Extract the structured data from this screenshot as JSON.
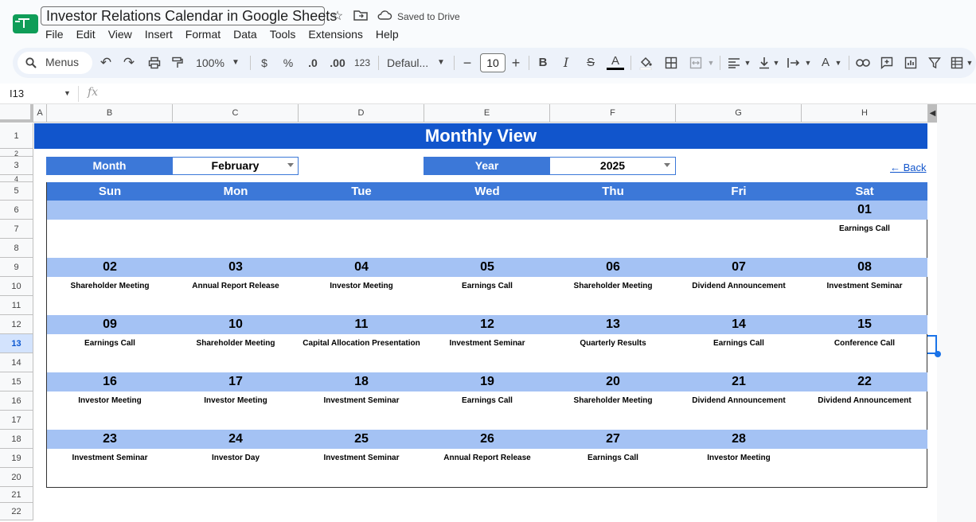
{
  "app": {
    "doc_title": "Investor Relations Calendar in Google Sheets",
    "saved_status": "Saved to Drive",
    "menu": [
      "File",
      "Edit",
      "View",
      "Insert",
      "Format",
      "Data",
      "Tools",
      "Extensions",
      "Help"
    ]
  },
  "toolbar": {
    "search_label": "Menus",
    "zoom": "100%",
    "currency": "$",
    "percent": "%",
    "dec_decrease": ".0",
    "dec_increase": ".00",
    "number_format": "123",
    "font": "Defaul...",
    "font_size": "10",
    "minus": "−",
    "plus": "+"
  },
  "formula_bar": {
    "name_box": "I13",
    "fx": "fx"
  },
  "columns": [
    "A",
    "B",
    "C",
    "D",
    "E",
    "F",
    "G",
    "H"
  ],
  "rows": [
    "1",
    "2",
    "3",
    "4",
    "5",
    "6",
    "7",
    "8",
    "9",
    "10",
    "11",
    "12",
    "13",
    "14",
    "15",
    "16",
    "17",
    "18",
    "19",
    "20",
    "21",
    "22"
  ],
  "selected_row": "13",
  "sheet": {
    "banner": "Monthly View",
    "month_label": "Month",
    "month_value": "February",
    "year_label": "Year",
    "year_value": "2025",
    "back_link": "← Back",
    "day_headers": [
      "Sun",
      "Mon",
      "Tue",
      "Wed",
      "Thu",
      "Fri",
      "Sat"
    ],
    "weeks": [
      {
        "dates": [
          "",
          "",
          "",
          "",
          "",
          "",
          "01"
        ],
        "events": [
          "",
          "",
          "",
          "",
          "",
          "",
          "Earnings Call"
        ]
      },
      {
        "dates": [
          "02",
          "03",
          "04",
          "05",
          "06",
          "07",
          "08"
        ],
        "events": [
          "Shareholder Meeting",
          "Annual Report Release",
          "Investor Meeting",
          "Earnings Call",
          "Shareholder Meeting",
          "Dividend Announcement",
          "Investment Seminar"
        ]
      },
      {
        "dates": [
          "09",
          "10",
          "11",
          "12",
          "13",
          "14",
          "15"
        ],
        "events": [
          "Earnings Call",
          "Shareholder Meeting",
          "Capital Allocation Presentation",
          "Investment Seminar",
          "Quarterly Results",
          "Earnings Call",
          "Conference Call"
        ]
      },
      {
        "dates": [
          "16",
          "17",
          "18",
          "19",
          "20",
          "21",
          "22"
        ],
        "events": [
          "Investor Meeting",
          "Investor Meeting",
          "Investment Seminar",
          "Earnings Call",
          "Shareholder Meeting",
          "Dividend Announcement",
          "Dividend Announcement"
        ]
      },
      {
        "dates": [
          "23",
          "24",
          "25",
          "26",
          "27",
          "28",
          ""
        ],
        "events": [
          "Investment Seminar",
          "Investor Day",
          "Investment Seminar",
          "Annual Report Release",
          "Earnings Call",
          "Investor Meeting",
          ""
        ]
      }
    ]
  },
  "colors": {
    "banner": "#1155cc",
    "header": "#3c78d8",
    "date_row": "#a4c2f4"
  }
}
